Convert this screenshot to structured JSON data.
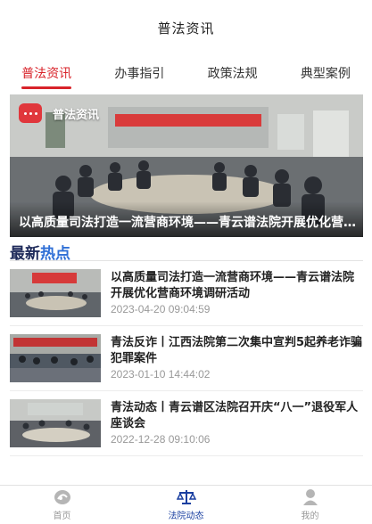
{
  "header": {
    "title": "普法资讯"
  },
  "tabs": [
    {
      "label": "普法资讯",
      "active": true
    },
    {
      "label": "办事指引",
      "active": false
    },
    {
      "label": "政策法规",
      "active": false
    },
    {
      "label": "典型案例",
      "active": false
    }
  ],
  "hero": {
    "badge": "普法资讯",
    "caption": "以高质量司法打造一流营商环境——青云谱法院开展优化营商环境调研活动",
    "badge_icon": "chat-bubble-icon",
    "badge_color": "#e0373c"
  },
  "section": {
    "title_part1": "最新",
    "title_part2": "热点"
  },
  "news": [
    {
      "title": "以高质量司法打造一流营商环境——青云谱法院开展优化营商环境调研活动",
      "date": "2023-04-20 09:04:59"
    },
    {
      "title": "青法反诈丨江西法院第二次集中宣判5起养老诈骗犯罪案件",
      "date": "2023-01-10 14:44:02"
    },
    {
      "title": "青法动态丨青云谱区法院召开庆“八一”退役军人座谈会",
      "date": "2022-12-28 09:10:06"
    }
  ],
  "bottom_nav": [
    {
      "label": "首页",
      "icon": "home-icon",
      "active": false
    },
    {
      "label": "法院动态",
      "icon": "scales-icon",
      "active": true
    },
    {
      "label": "我的",
      "icon": "user-icon",
      "active": false
    }
  ],
  "colors": {
    "accent": "#d8232a",
    "nav_active": "#1a3fa0",
    "hot": "#2f6fd6"
  }
}
